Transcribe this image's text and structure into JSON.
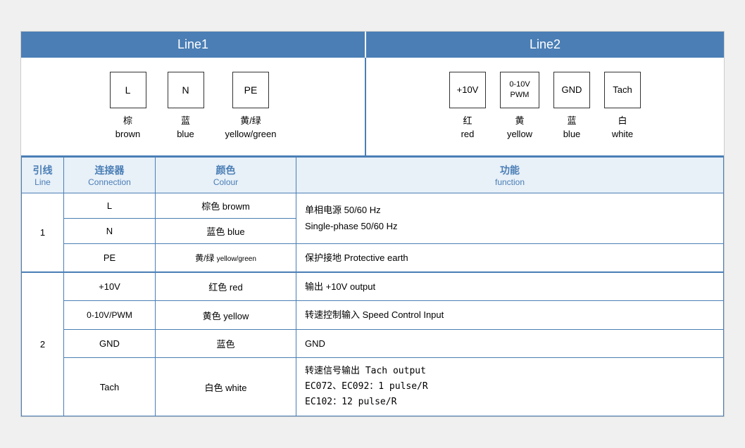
{
  "header": {
    "line1_label": "Line1",
    "line2_label": "Line2"
  },
  "diagram": {
    "line1": [
      {
        "symbol": "L",
        "zh": "棕",
        "en": "brown"
      },
      {
        "symbol": "N",
        "zh": "蓝",
        "en": "blue"
      },
      {
        "symbol": "PE",
        "zh": "黄/绿",
        "en": "yellow/green"
      }
    ],
    "line2": [
      {
        "symbol": "+10V",
        "zh": "红",
        "en": "red"
      },
      {
        "symbol": "0-10V\nPWM",
        "zh": "黄",
        "en": "yellow"
      },
      {
        "symbol": "GND",
        "zh": "蓝",
        "en": "blue"
      },
      {
        "symbol": "Tach",
        "zh": "白",
        "en": "white"
      }
    ]
  },
  "table": {
    "headers": {
      "line_zh": "引线",
      "line_en": "Line",
      "conn_zh": "连接器",
      "conn_en": "Connection",
      "colour_zh": "颜色",
      "colour_en": "Colour",
      "func_zh": "功能",
      "func_en": "function"
    },
    "rows": [
      {
        "line": "1",
        "rowspan": 3,
        "entries": [
          {
            "conn": "L",
            "colour": "棕色 browm",
            "func": "单相电源 50/60 Hz\nSingle-phase 50/60 Hz"
          },
          {
            "conn": "N",
            "colour": "蓝色 blue",
            "func": ""
          },
          {
            "conn": "PE",
            "colour": "黄/绿 yellow/green",
            "func": "保护接地 Protective earth"
          }
        ]
      },
      {
        "line": "2",
        "rowspan": 4,
        "entries": [
          {
            "conn": "+10V",
            "colour": "红色 red",
            "func": "输出 +10V output"
          },
          {
            "conn": "0-10V/PWM",
            "colour": "黄色 yellow",
            "func": "转速控制输入 Speed Control Input"
          },
          {
            "conn": "GND",
            "colour": "蓝色",
            "func": "GND"
          },
          {
            "conn": "Tach",
            "colour": "白色 white",
            "func": "转速信号输出 Tach output\nEC072、EC092：1 pulse/R\nEC102：12 pulse/R"
          }
        ]
      }
    ]
  }
}
